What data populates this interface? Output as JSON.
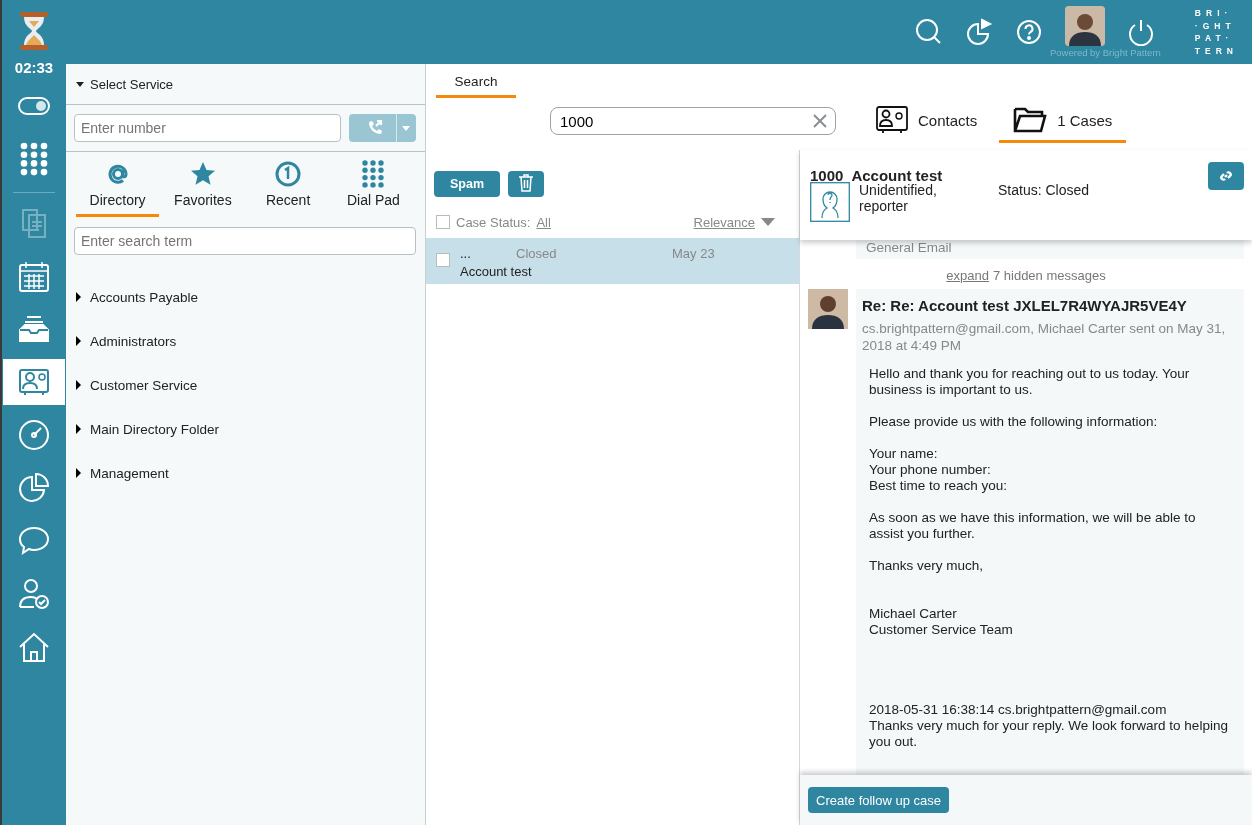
{
  "timer": "02:33",
  "rail_top": [
    {
      "kind": "toggle",
      "selected": false,
      "disabled": false
    },
    {
      "kind": "dialpad",
      "selected": false,
      "disabled": false
    }
  ],
  "rail_main": [
    {
      "kind": "documents",
      "selected": false,
      "disabled": true
    },
    {
      "kind": "calendar",
      "selected": false,
      "disabled": false
    },
    {
      "kind": "inbox",
      "selected": false,
      "disabled": false
    },
    {
      "kind": "contacts",
      "selected": true,
      "disabled": false
    },
    {
      "kind": "gauge",
      "selected": false,
      "disabled": false
    },
    {
      "kind": "reports",
      "selected": false,
      "disabled": false
    },
    {
      "kind": "chat",
      "selected": false,
      "disabled": false
    },
    {
      "kind": "user",
      "selected": false,
      "disabled": false
    },
    {
      "kind": "home",
      "selected": false,
      "disabled": false
    }
  ],
  "topbar": {
    "items": [
      {
        "kind": "search"
      },
      {
        "kind": "reports"
      },
      {
        "kind": "help"
      },
      {
        "kind": "avatar"
      },
      {
        "kind": "power"
      }
    ],
    "powered_by": "Powered by Bright Pattern",
    "logo": [
      "BRI·",
      "·GHT",
      "PAT·",
      "TERN"
    ]
  },
  "left_panel": {
    "service": {
      "label": "Select Service",
      "expanded": true
    },
    "number_field": {
      "placeholder": "Enter number"
    },
    "call_button": {
      "disabled": true
    },
    "tabs": [
      {
        "kind": "directory",
        "label": "Directory",
        "selected": true
      },
      {
        "kind": "favorites",
        "label": "Favorites",
        "selected": false
      },
      {
        "kind": "recent",
        "label": "Recent",
        "selected": false
      },
      {
        "kind": "dialpad",
        "label": "Dial Pad",
        "selected": false
      }
    ],
    "search_field": {
      "placeholder": "Enter search term"
    },
    "folders": [
      {
        "label": "Accounts Payable",
        "expanded": false
      },
      {
        "label": "Administrators",
        "expanded": false
      },
      {
        "label": "Customer Service",
        "expanded": false
      },
      {
        "label": "Main Directory Folder",
        "expanded": false
      },
      {
        "label": "Management",
        "expanded": false
      }
    ]
  },
  "search_tab": {
    "label": "Search",
    "selected": true
  },
  "search_field": {
    "value": "1000"
  },
  "result_tabs": [
    {
      "kind": "contacts",
      "label": "Contacts",
      "selected": false
    },
    {
      "kind": "cases",
      "label": "1 Cases",
      "selected": true
    }
  ],
  "cases": {
    "spam_button": "Spam",
    "filter": {
      "checked": false,
      "label": "Case Status:",
      "value": "All",
      "sort": "Relevance"
    },
    "rows": [
      {
        "checked": false,
        "selected": true,
        "number": "...",
        "status": "Closed",
        "date": "May 23",
        "subject": "Account test"
      }
    ]
  },
  "detail": {
    "number": "1000",
    "title": "Account test",
    "reporter": "Unidentified, reporter",
    "status": "Status: Closed",
    "previous_label": "General Email",
    "expand_link": "expand",
    "hidden_note": "7 hidden messages",
    "message": {
      "subject": "Re: Re: Account test JXLEL7R4WYAJR5VE4Y",
      "meta": "cs.brightpattern@gmail.com, Michael Carter sent on May 31, 2018 at 4:49 PM",
      "paragraphs": [
        {
          "kind": "text",
          "lines": [
            "Hello and thank you for reaching out to us today. Your business is important to us."
          ]
        },
        {
          "kind": "text",
          "lines": [
            "Please provide us with the following information:"
          ]
        },
        {
          "kind": "text",
          "lines": [
            "Your name:",
            "Your phone number:",
            "Best time to reach you:"
          ]
        },
        {
          "kind": "text",
          "lines": [
            "As soon as we have this information, we will be able to assist you further."
          ]
        },
        {
          "kind": "text",
          "lines": [
            "Thanks very much,"
          ]
        },
        {
          "kind": "signature",
          "lines": [
            "Michael Carter",
            "Customer Service Team"
          ]
        },
        {
          "kind": "quoted",
          "lines": [
            "2018-05-31 16:38:14 cs.brightpattern@gmail.com",
            "Thanks very much for your reply. We look forward to helping you out."
          ]
        }
      ]
    },
    "follow_up_button": "Create follow up case"
  }
}
